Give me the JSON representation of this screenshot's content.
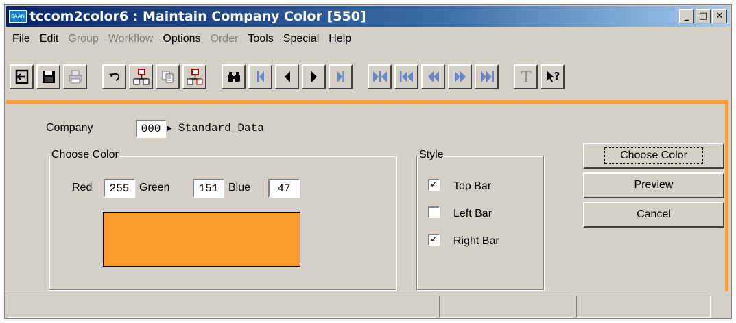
{
  "window": {
    "title": "tccom2color6 : Maintain Company Color [550]",
    "app_icon_text": "BAAN",
    "buttons": {
      "minimize": "_",
      "maximize": "□",
      "close": "✕"
    }
  },
  "menu": [
    {
      "label": "File",
      "ul": "F",
      "rest": "ile",
      "enabled": true
    },
    {
      "label": "Edit",
      "ul": "E",
      "rest": "dit",
      "enabled": true
    },
    {
      "label": "Group",
      "ul": "G",
      "rest": "roup",
      "enabled": false
    },
    {
      "label": "Workflow",
      "ul": "W",
      "rest": "orkflow",
      "enabled": false
    },
    {
      "label": "Options",
      "ul": "O",
      "rest": "ptions",
      "enabled": true
    },
    {
      "label": "Order",
      "ul": "",
      "rest": "Order",
      "enabled": false
    },
    {
      "label": "Tools",
      "ul": "T",
      "rest": "ools",
      "enabled": true
    },
    {
      "label": "Special",
      "ul": "S",
      "rest": "pecial",
      "enabled": true
    },
    {
      "label": "Help",
      "ul": "H",
      "rest": "elp",
      "enabled": true
    }
  ],
  "toolbar": [
    "exit-icon",
    "save-icon",
    "print-icon",
    "undo-icon",
    "insert-record-icon",
    "duplicate-icon",
    "delete-record-icon",
    "find-icon",
    "first-record-icon",
    "previous-record-icon",
    "next-record-icon",
    "last-record-icon",
    "first-set-icon",
    "previous-set-icon",
    "previous-page-icon",
    "next-page-icon",
    "last-set-icon",
    "text-icon",
    "context-help-icon"
  ],
  "form": {
    "company_label": "Company",
    "company_value": "000",
    "company_arrow": "▸",
    "company_description": "Standard_Data",
    "choose_color_group": "Choose Color",
    "red_label": "Red",
    "red_value": "255",
    "green_label": "Green",
    "green_value": "151",
    "blue_label": "Blue",
    "blue_value": "47",
    "swatch_color": "#fd9a30",
    "style_group": "Style",
    "styles": [
      {
        "label": "Top Bar",
        "checked": true
      },
      {
        "label": "Left Bar",
        "checked": false
      },
      {
        "label": "Right Bar",
        "checked": true
      }
    ],
    "check_mark": "✓",
    "buttons": {
      "choose_color": "Choose Color",
      "preview": "Preview",
      "cancel": "Cancel"
    }
  },
  "colors": {
    "accent_bar": "#fd9a30",
    "title_bar": "#0a246a"
  }
}
